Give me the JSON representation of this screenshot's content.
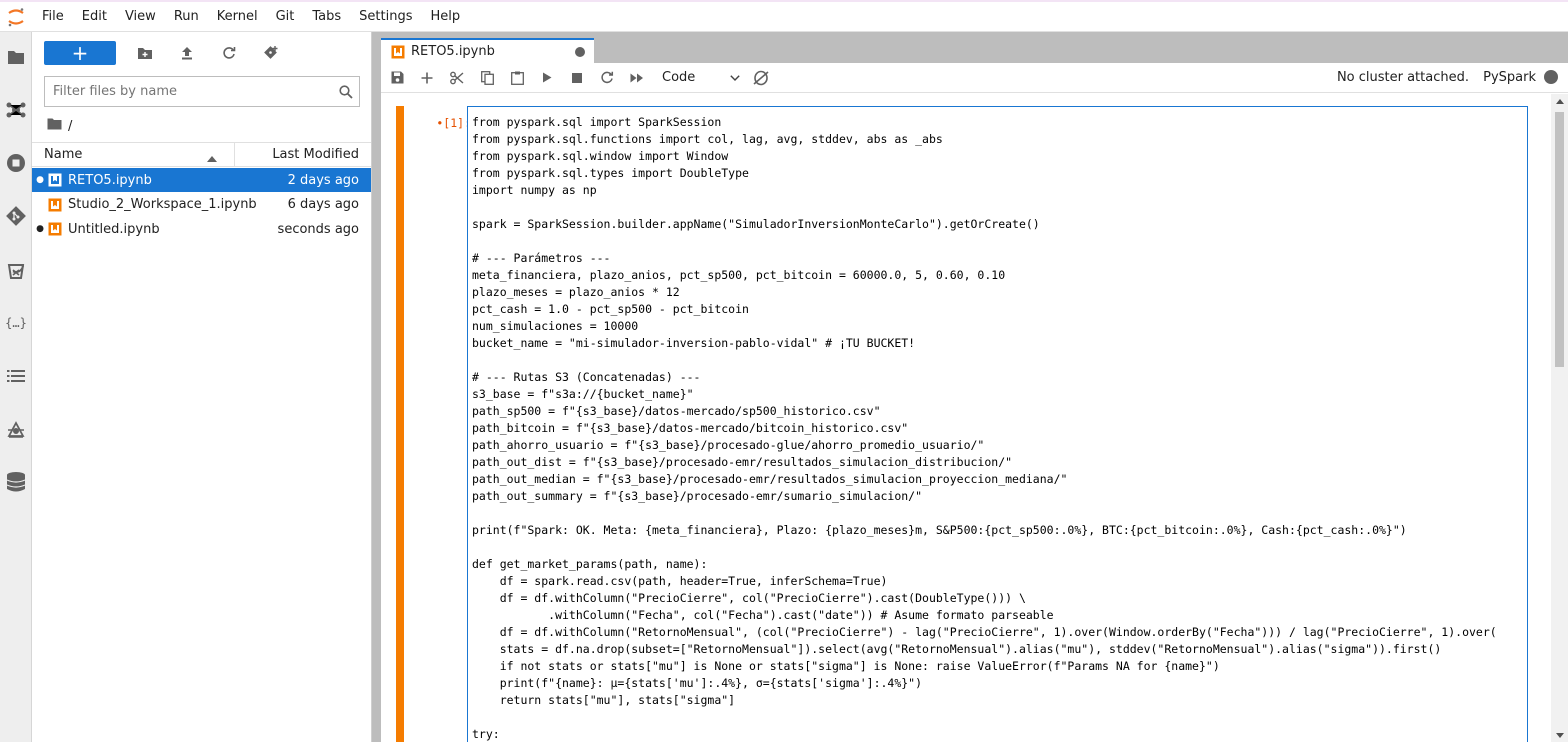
{
  "menu": [
    "File",
    "Edit",
    "View",
    "Run",
    "Kernel",
    "Git",
    "Tabs",
    "Settings",
    "Help"
  ],
  "activity_bar": [
    "folder-icon",
    "running-kernels-icon",
    "stop-icon",
    "git-icon",
    "extension-icon",
    "variables-icon",
    "toc-icon",
    "debugger-icon",
    "database-icon"
  ],
  "file_browser": {
    "new_label": "+",
    "filter_placeholder": "Filter files by name",
    "breadcrumb": "/",
    "columns": {
      "name": "Name",
      "modified": "Last Modified"
    },
    "files": [
      {
        "name": "RETO5.ipynb",
        "modified": "2 days ago",
        "running": true,
        "selected": true
      },
      {
        "name": "Studio_2_Workspace_1.ipynb",
        "modified": "6 days ago",
        "running": false,
        "selected": false
      },
      {
        "name": "Untitled.ipynb",
        "modified": "seconds ago",
        "running": true,
        "selected": false
      }
    ]
  },
  "tab": {
    "title": "RETO5.ipynb"
  },
  "notebook_toolbar": {
    "cell_type": "Code",
    "cluster_status": "No cluster attached.",
    "kernel": "PySpark"
  },
  "cell": {
    "prompt": "•[1]:",
    "code": [
      "from pyspark.sql import SparkSession",
      "from pyspark.sql.functions import col, lag, avg, stddev, abs as _abs",
      "from pyspark.sql.window import Window",
      "from pyspark.sql.types import DoubleType",
      "import numpy as np",
      "",
      "spark = SparkSession.builder.appName(\"SimuladorInversionMonteCarlo\").getOrCreate()",
      "",
      "# --- Parámetros ---",
      "meta_financiera, plazo_anios, pct_sp500, pct_bitcoin = 60000.0, 5, 0.60, 0.10",
      "plazo_meses = plazo_anios * 12",
      "pct_cash = 1.0 - pct_sp500 - pct_bitcoin",
      "num_simulaciones = 10000",
      "bucket_name = \"mi-simulador-inversion-pablo-vidal\" # ¡TU BUCKET!",
      "",
      "# --- Rutas S3 (Concatenadas) ---",
      "s3_base = f\"s3a://{bucket_name}\"",
      "path_sp500 = f\"{s3_base}/datos-mercado/sp500_historico.csv\"",
      "path_bitcoin = f\"{s3_base}/datos-mercado/bitcoin_historico.csv\"",
      "path_ahorro_usuario = f\"{s3_base}/procesado-glue/ahorro_promedio_usuario/\"",
      "path_out_dist = f\"{s3_base}/procesado-emr/resultados_simulacion_distribucion/\"",
      "path_out_median = f\"{s3_base}/procesado-emr/resultados_simulacion_proyeccion_mediana/\"",
      "path_out_summary = f\"{s3_base}/procesado-emr/sumario_simulacion/\"",
      "",
      "print(f\"Spark: OK. Meta: {meta_financiera}, Plazo: {plazo_meses}m, S&P500:{pct_sp500:.0%}, BTC:{pct_bitcoin:.0%}, Cash:{pct_cash:.0%}\")",
      "",
      "def get_market_params(path, name):",
      "    df = spark.read.csv(path, header=True, inferSchema=True)",
      "    df = df.withColumn(\"PrecioCierre\", col(\"PrecioCierre\").cast(DoubleType())) \\",
      "           .withColumn(\"Fecha\", col(\"Fecha\").cast(\"date\")) # Asume formato parseable",
      "    df = df.withColumn(\"RetornoMensual\", (col(\"PrecioCierre\") - lag(\"PrecioCierre\", 1).over(Window.orderBy(\"Fecha\"))) / lag(\"PrecioCierre\", 1).over(",
      "    stats = df.na.drop(subset=[\"RetornoMensual\"]).select(avg(\"RetornoMensual\").alias(\"mu\"), stddev(\"RetornoMensual\").alias(\"sigma\")).first()",
      "    if not stats or stats[\"mu\"] is None or stats[\"sigma\"] is None: raise ValueError(f\"Params NA for {name}\")",
      "    print(f\"{name}: μ={stats['mu']:.4%}, σ={stats['sigma']:.4%}\")",
      "    return stats[\"mu\"], stats[\"sigma\"]",
      "",
      "try:"
    ]
  },
  "colors": {
    "accent": "#1976d2",
    "cell_collapser": "#f57c00",
    "prompt": "#e65100",
    "file_icon": "#f57c00"
  }
}
